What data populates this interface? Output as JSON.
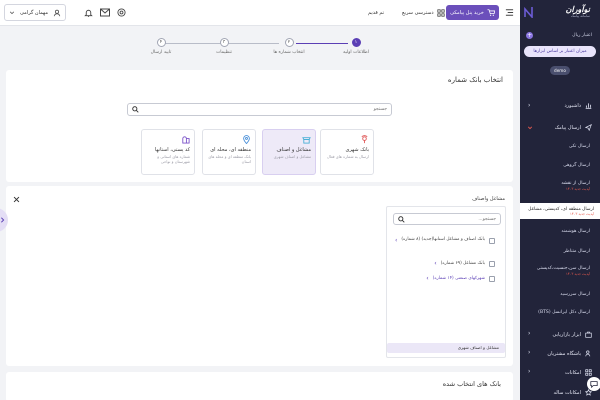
{
  "header": {
    "user_name": "مهمان گرامی",
    "buy_button": "خرید پنل پیامکی",
    "quick_access": "دسترسی سریع",
    "free_trial": "تم قدیم"
  },
  "steps": [
    {
      "num": "۱",
      "label": "اطلاعات اولیه"
    },
    {
      "num": "۲",
      "label": "انتخاب شماره ها"
    },
    {
      "num": "۳",
      "label": "تنظیمات"
    },
    {
      "num": "۴",
      "label": "تایید ارسال"
    }
  ],
  "bank": {
    "title": "انتخاب بانک شماره",
    "search_placeholder": "جستجو",
    "options": [
      {
        "title": "بانک شهری",
        "desc": "ارسال به شماره های فعال"
      },
      {
        "title": "مشاغل و اصناف",
        "desc": "مشاغل و اصناف شهری"
      },
      {
        "title": "منطقه ای، محله ای",
        "desc": "بانک منطقه ای و محله های استان"
      },
      {
        "title": "کد پستی، استانها",
        "desc": "شماره های استانی و شهرستان و نواحی"
      }
    ]
  },
  "jobs": {
    "title": "مشاغل واصناف",
    "search_placeholder": "جستجو...",
    "items": [
      {
        "label": "بانک اصناف و مشاغل استانها(جدید) (۸ شماره)"
      },
      {
        "label": "بانک مشاغل (۶۹ شماره)"
      },
      {
        "label": "شهرکهای صنعتی (۱۴ شماره)"
      }
    ],
    "selected_chip": "مشاغل و اصناف شهری"
  },
  "selected_banks": {
    "title": "بانک های انتخاب شده"
  },
  "sidebar": {
    "logo_text": "نوآوران",
    "logo_sub": "سامانه پیامک",
    "credit_label": "اعتبار ریال",
    "credit_button": "میزان اعتبار بر اساس ابزارها",
    "demo": "demo",
    "dashboard": "داشبورد",
    "send_sms": "ارسال پیامک",
    "sub_items": [
      {
        "label": "ارسال تکی",
        "tag": ""
      },
      {
        "label": "ارسال گروهی",
        "tag": ""
      },
      {
        "label": "ارسال از نقشه",
        "tag": "آپدیت جدید ۱۴۰۳"
      },
      {
        "label": "ارسال منطقه ای، کدپستی، مشاغل",
        "tag": "آپدیت جدید ۱۴۰۳"
      },
      {
        "label": "ارسال هوشمند",
        "tag": ""
      },
      {
        "label": "ارسال متناظر",
        "tag": ""
      },
      {
        "label": "ارسال سن،جنسیت،کدپستی",
        "tag": "آپدیت جدید ۱۴۰۳"
      },
      {
        "label": "ارسال سررسید",
        "tag": ""
      },
      {
        "label": "ارسال دکل ایرانسل (BTS)",
        "tag": ""
      }
    ],
    "marketing": "ابزار بازاریابی",
    "customers": "باشگاه مشتریان",
    "features": "امکانات",
    "yearly": "امکانات ساله"
  }
}
